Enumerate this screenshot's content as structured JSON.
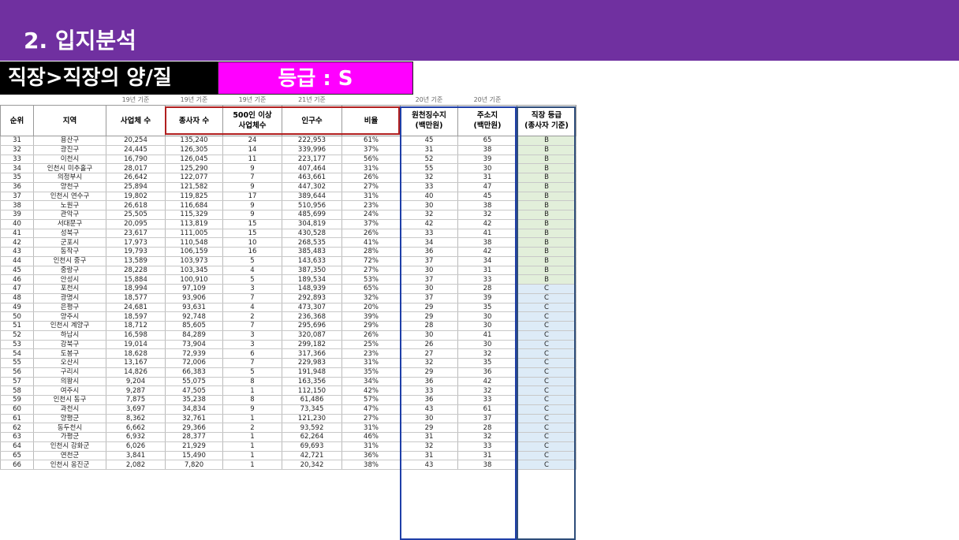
{
  "header": {
    "section_title": "2. 입지분석",
    "category_label": "직장>직장의 양/질",
    "grade_label": "등급 : S"
  },
  "table": {
    "basis": [
      "",
      "",
      "19년 기준",
      "19년 기준",
      "19년 기준",
      "21년 기준",
      "",
      "20년 기준",
      "20년 기준",
      ""
    ],
    "columns": [
      "순위",
      "지역",
      "사업체 수",
      "종사자 수",
      "500인 이상\n사업체수",
      "인구수",
      "비율",
      "원천징수지\n(백만원)",
      "주소지\n(백만원)",
      "직장 등급\n(종사자 기준)"
    ],
    "rows": [
      [
        "31",
        "용산구",
        "20,254",
        "135,240",
        "24",
        "222,953",
        "61%",
        "45",
        "65",
        "B"
      ],
      [
        "32",
        "광진구",
        "24,445",
        "126,305",
        "14",
        "339,996",
        "37%",
        "31",
        "38",
        "B"
      ],
      [
        "33",
        "이천시",
        "16,790",
        "126,045",
        "11",
        "223,177",
        "56%",
        "52",
        "39",
        "B"
      ],
      [
        "34",
        "인천시 미추홀구",
        "28,017",
        "125,290",
        "9",
        "407,464",
        "31%",
        "55",
        "30",
        "B"
      ],
      [
        "35",
        "의정부시",
        "26,642",
        "122,077",
        "7",
        "463,661",
        "26%",
        "32",
        "31",
        "B"
      ],
      [
        "36",
        "양천구",
        "25,894",
        "121,582",
        "9",
        "447,302",
        "27%",
        "33",
        "47",
        "B"
      ],
      [
        "37",
        "인천시 연수구",
        "19,802",
        "119,825",
        "17",
        "389,644",
        "31%",
        "40",
        "45",
        "B"
      ],
      [
        "38",
        "노원구",
        "26,618",
        "116,684",
        "9",
        "510,956",
        "23%",
        "30",
        "38",
        "B"
      ],
      [
        "39",
        "관악구",
        "25,505",
        "115,329",
        "9",
        "485,699",
        "24%",
        "32",
        "32",
        "B"
      ],
      [
        "40",
        "서대문구",
        "20,095",
        "113,819",
        "15",
        "304,819",
        "37%",
        "42",
        "42",
        "B"
      ],
      [
        "41",
        "성북구",
        "23,617",
        "111,005",
        "15",
        "430,528",
        "26%",
        "33",
        "41",
        "B"
      ],
      [
        "42",
        "군포시",
        "17,973",
        "110,548",
        "10",
        "268,535",
        "41%",
        "34",
        "38",
        "B"
      ],
      [
        "43",
        "동작구",
        "19,793",
        "106,159",
        "16",
        "385,483",
        "28%",
        "36",
        "42",
        "B"
      ],
      [
        "44",
        "인천시 중구",
        "13,589",
        "103,973",
        "5",
        "143,633",
        "72%",
        "37",
        "34",
        "B"
      ],
      [
        "45",
        "중랑구",
        "28,228",
        "103,345",
        "4",
        "387,350",
        "27%",
        "30",
        "31",
        "B"
      ],
      [
        "46",
        "안성시",
        "15,884",
        "100,910",
        "5",
        "189,534",
        "53%",
        "37",
        "33",
        "B"
      ],
      [
        "47",
        "포천시",
        "18,994",
        "97,109",
        "3",
        "148,939",
        "65%",
        "30",
        "28",
        "C"
      ],
      [
        "48",
        "광명시",
        "18,577",
        "93,906",
        "7",
        "292,893",
        "32%",
        "37",
        "39",
        "C"
      ],
      [
        "49",
        "은평구",
        "24,681",
        "93,631",
        "4",
        "473,307",
        "20%",
        "29",
        "35",
        "C"
      ],
      [
        "50",
        "양주시",
        "18,597",
        "92,748",
        "2",
        "236,368",
        "39%",
        "29",
        "30",
        "C"
      ],
      [
        "51",
        "인천시 계양구",
        "18,712",
        "85,605",
        "7",
        "295,696",
        "29%",
        "28",
        "30",
        "C"
      ],
      [
        "52",
        "하남시",
        "16,598",
        "84,289",
        "3",
        "320,087",
        "26%",
        "30",
        "41",
        "C"
      ],
      [
        "53",
        "강북구",
        "19,014",
        "73,904",
        "3",
        "299,182",
        "25%",
        "26",
        "30",
        "C"
      ],
      [
        "54",
        "도봉구",
        "18,628",
        "72,939",
        "6",
        "317,366",
        "23%",
        "27",
        "32",
        "C"
      ],
      [
        "55",
        "오산시",
        "13,167",
        "72,006",
        "7",
        "229,983",
        "31%",
        "32",
        "35",
        "C"
      ],
      [
        "56",
        "구리시",
        "14,826",
        "66,383",
        "5",
        "191,948",
        "35%",
        "29",
        "36",
        "C"
      ],
      [
        "57",
        "의왕시",
        "9,204",
        "55,075",
        "8",
        "163,356",
        "34%",
        "36",
        "42",
        "C"
      ],
      [
        "58",
        "여주시",
        "9,287",
        "47,505",
        "1",
        "112,150",
        "42%",
        "33",
        "32",
        "C"
      ],
      [
        "59",
        "인천시 동구",
        "7,875",
        "35,238",
        "8",
        "61,486",
        "57%",
        "36",
        "33",
        "C"
      ],
      [
        "60",
        "과천시",
        "3,697",
        "34,834",
        "9",
        "73,345",
        "47%",
        "43",
        "61",
        "C"
      ],
      [
        "61",
        "양평군",
        "8,362",
        "32,761",
        "1",
        "121,230",
        "27%",
        "30",
        "37",
        "C"
      ],
      [
        "62",
        "동두천시",
        "6,662",
        "29,366",
        "2",
        "93,592",
        "31%",
        "29",
        "28",
        "C"
      ],
      [
        "63",
        "가평군",
        "6,932",
        "28,377",
        "1",
        "62,264",
        "46%",
        "31",
        "32",
        "C"
      ],
      [
        "64",
        "인천시 강화군",
        "6,026",
        "21,929",
        "1",
        "69,693",
        "31%",
        "32",
        "33",
        "C"
      ],
      [
        "65",
        "연천군",
        "3,841",
        "15,490",
        "1",
        "42,721",
        "36%",
        "31",
        "31",
        "C"
      ],
      [
        "66",
        "인천시 옹진군",
        "2,082",
        "7,820",
        "1",
        "20,342",
        "38%",
        "43",
        "38",
        "C"
      ]
    ]
  },
  "colors": {
    "banner": "#7030a0",
    "grade_bg": "#ff00ff",
    "grade_b_fill": "#e2efda",
    "grade_c_fill": "#ddebf7",
    "highlight_red": "#b11f1f",
    "highlight_blue": "#1f3fa8"
  }
}
